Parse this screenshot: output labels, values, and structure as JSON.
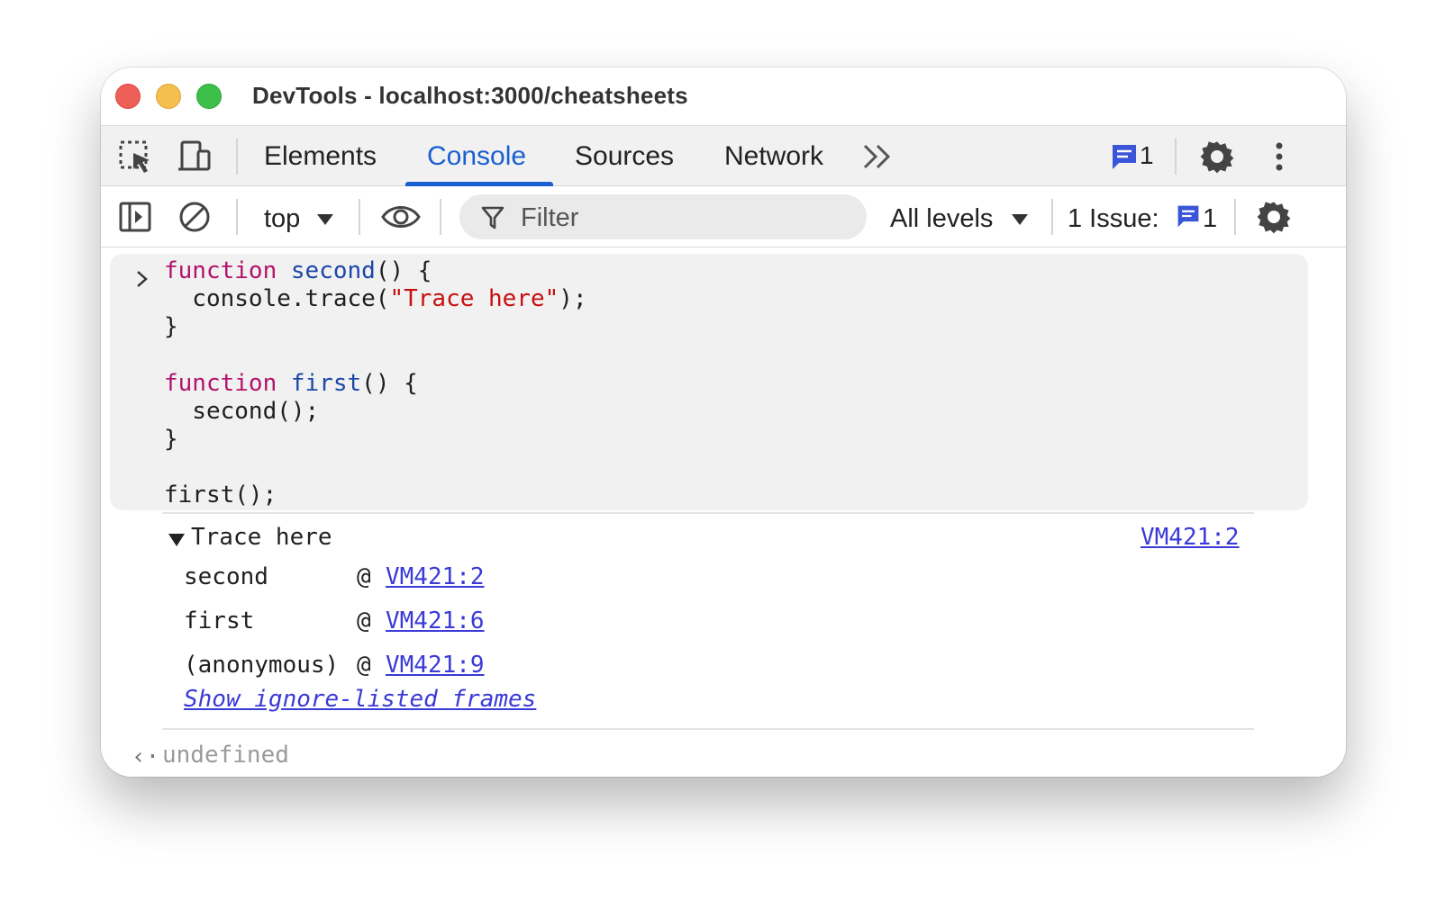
{
  "window": {
    "title": "DevTools - localhost:3000/cheatsheets"
  },
  "tabs": {
    "items": [
      "Elements",
      "Console",
      "Sources",
      "Network"
    ],
    "active": "Console",
    "more_icon": "chevrons-right-icon",
    "issues_badge_count": "1"
  },
  "toolbar": {
    "context": "top",
    "filter_placeholder": "Filter",
    "levels": "All levels",
    "issues_label": "1 Issue:",
    "issues_count": "1"
  },
  "colors": {
    "accent": "#1a5fd0",
    "keyword": "#b3126b",
    "function_name": "#1b47a8",
    "string": "#c80f0f",
    "link": "#3a3ad6"
  },
  "console": {
    "input_code": {
      "line1_kw": "function",
      "line1_name": "second",
      "line1_rest": "() {",
      "line2_pre": "  console.trace(",
      "line2_str": "\"Trace here\"",
      "line2_post": ");",
      "line3": "}",
      "line5_kw": "function",
      "line5_name": "first",
      "line5_rest": "() {",
      "line6": "  second();",
      "line7": "}",
      "line9": "first();"
    },
    "trace": {
      "message": "Trace here",
      "source_link": "VM421:2",
      "frames": [
        {
          "name": "second",
          "at": "@",
          "link": "VM421:2"
        },
        {
          "name": "first",
          "at": "@",
          "link": "VM421:6"
        },
        {
          "name": "(anonymous)",
          "at": "@",
          "link": "VM421:9"
        }
      ],
      "show_ignored": "Show ignore-listed frames"
    },
    "result": "undefined"
  }
}
